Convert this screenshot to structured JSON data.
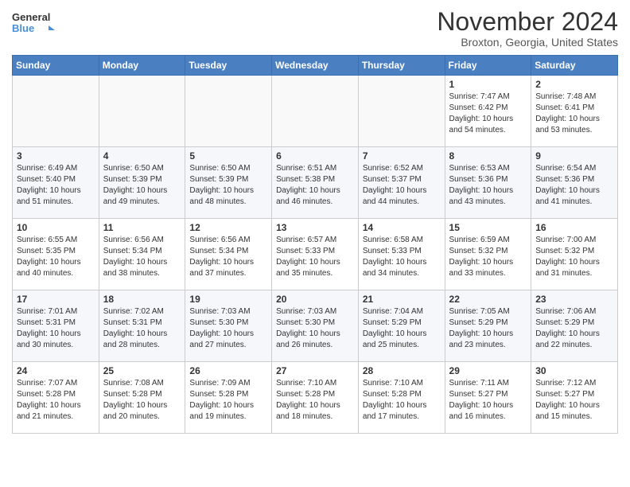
{
  "header": {
    "logo_line1": "General",
    "logo_line2": "Blue",
    "month": "November 2024",
    "location": "Broxton, Georgia, United States"
  },
  "days_of_week": [
    "Sunday",
    "Monday",
    "Tuesday",
    "Wednesday",
    "Thursday",
    "Friday",
    "Saturday"
  ],
  "weeks": [
    [
      {
        "day": "",
        "info": ""
      },
      {
        "day": "",
        "info": ""
      },
      {
        "day": "",
        "info": ""
      },
      {
        "day": "",
        "info": ""
      },
      {
        "day": "",
        "info": ""
      },
      {
        "day": "1",
        "info": "Sunrise: 7:47 AM\nSunset: 6:42 PM\nDaylight: 10 hours and 54 minutes."
      },
      {
        "day": "2",
        "info": "Sunrise: 7:48 AM\nSunset: 6:41 PM\nDaylight: 10 hours and 53 minutes."
      }
    ],
    [
      {
        "day": "3",
        "info": "Sunrise: 6:49 AM\nSunset: 5:40 PM\nDaylight: 10 hours and 51 minutes."
      },
      {
        "day": "4",
        "info": "Sunrise: 6:50 AM\nSunset: 5:39 PM\nDaylight: 10 hours and 49 minutes."
      },
      {
        "day": "5",
        "info": "Sunrise: 6:50 AM\nSunset: 5:39 PM\nDaylight: 10 hours and 48 minutes."
      },
      {
        "day": "6",
        "info": "Sunrise: 6:51 AM\nSunset: 5:38 PM\nDaylight: 10 hours and 46 minutes."
      },
      {
        "day": "7",
        "info": "Sunrise: 6:52 AM\nSunset: 5:37 PM\nDaylight: 10 hours and 44 minutes."
      },
      {
        "day": "8",
        "info": "Sunrise: 6:53 AM\nSunset: 5:36 PM\nDaylight: 10 hours and 43 minutes."
      },
      {
        "day": "9",
        "info": "Sunrise: 6:54 AM\nSunset: 5:36 PM\nDaylight: 10 hours and 41 minutes."
      }
    ],
    [
      {
        "day": "10",
        "info": "Sunrise: 6:55 AM\nSunset: 5:35 PM\nDaylight: 10 hours and 40 minutes."
      },
      {
        "day": "11",
        "info": "Sunrise: 6:56 AM\nSunset: 5:34 PM\nDaylight: 10 hours and 38 minutes."
      },
      {
        "day": "12",
        "info": "Sunrise: 6:56 AM\nSunset: 5:34 PM\nDaylight: 10 hours and 37 minutes."
      },
      {
        "day": "13",
        "info": "Sunrise: 6:57 AM\nSunset: 5:33 PM\nDaylight: 10 hours and 35 minutes."
      },
      {
        "day": "14",
        "info": "Sunrise: 6:58 AM\nSunset: 5:33 PM\nDaylight: 10 hours and 34 minutes."
      },
      {
        "day": "15",
        "info": "Sunrise: 6:59 AM\nSunset: 5:32 PM\nDaylight: 10 hours and 33 minutes."
      },
      {
        "day": "16",
        "info": "Sunrise: 7:00 AM\nSunset: 5:32 PM\nDaylight: 10 hours and 31 minutes."
      }
    ],
    [
      {
        "day": "17",
        "info": "Sunrise: 7:01 AM\nSunset: 5:31 PM\nDaylight: 10 hours and 30 minutes."
      },
      {
        "day": "18",
        "info": "Sunrise: 7:02 AM\nSunset: 5:31 PM\nDaylight: 10 hours and 28 minutes."
      },
      {
        "day": "19",
        "info": "Sunrise: 7:03 AM\nSunset: 5:30 PM\nDaylight: 10 hours and 27 minutes."
      },
      {
        "day": "20",
        "info": "Sunrise: 7:03 AM\nSunset: 5:30 PM\nDaylight: 10 hours and 26 minutes."
      },
      {
        "day": "21",
        "info": "Sunrise: 7:04 AM\nSunset: 5:29 PM\nDaylight: 10 hours and 25 minutes."
      },
      {
        "day": "22",
        "info": "Sunrise: 7:05 AM\nSunset: 5:29 PM\nDaylight: 10 hours and 23 minutes."
      },
      {
        "day": "23",
        "info": "Sunrise: 7:06 AM\nSunset: 5:29 PM\nDaylight: 10 hours and 22 minutes."
      }
    ],
    [
      {
        "day": "24",
        "info": "Sunrise: 7:07 AM\nSunset: 5:28 PM\nDaylight: 10 hours and 21 minutes."
      },
      {
        "day": "25",
        "info": "Sunrise: 7:08 AM\nSunset: 5:28 PM\nDaylight: 10 hours and 20 minutes."
      },
      {
        "day": "26",
        "info": "Sunrise: 7:09 AM\nSunset: 5:28 PM\nDaylight: 10 hours and 19 minutes."
      },
      {
        "day": "27",
        "info": "Sunrise: 7:10 AM\nSunset: 5:28 PM\nDaylight: 10 hours and 18 minutes."
      },
      {
        "day": "28",
        "info": "Sunrise: 7:10 AM\nSunset: 5:28 PM\nDaylight: 10 hours and 17 minutes."
      },
      {
        "day": "29",
        "info": "Sunrise: 7:11 AM\nSunset: 5:27 PM\nDaylight: 10 hours and 16 minutes."
      },
      {
        "day": "30",
        "info": "Sunrise: 7:12 AM\nSunset: 5:27 PM\nDaylight: 10 hours and 15 minutes."
      }
    ]
  ]
}
